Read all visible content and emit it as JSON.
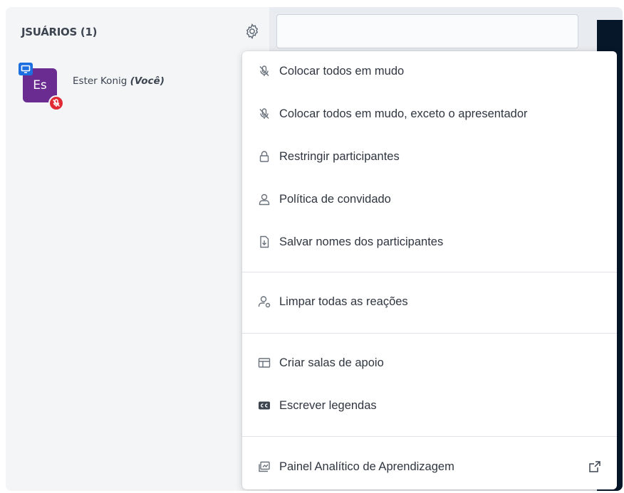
{
  "users_panel": {
    "title": "JSUÁRIOS (1)",
    "user": {
      "initials": "Es",
      "name": "Ester Konig",
      "you_tag": "(Você)"
    }
  },
  "menu": {
    "items": [
      {
        "label": "Colocar todos em mudo",
        "icon": "mic-off-icon"
      },
      {
        "label": "Colocar todos em mudo, exceto o apresentador",
        "icon": "mic-off-icon"
      },
      {
        "label": "Restringir participantes",
        "icon": "lock-icon"
      },
      {
        "label": "Política de convidado",
        "icon": "user-icon"
      },
      {
        "label": "Salvar nomes dos participantes",
        "icon": "download-file-icon"
      },
      {
        "label": "Limpar todas as reações",
        "icon": "clear-reactions-icon"
      },
      {
        "label": "Criar salas de apoio",
        "icon": "breakout-rooms-icon"
      },
      {
        "label": "Escrever legendas",
        "icon": "closed-captions-icon"
      },
      {
        "label": "Painel Analítico de Aprendizagem",
        "icon": "analytics-icon"
      }
    ]
  },
  "colors": {
    "avatar": "#6b2c91",
    "presenter_badge": "#1d6fe0",
    "muted_badge": "#e02b35"
  }
}
